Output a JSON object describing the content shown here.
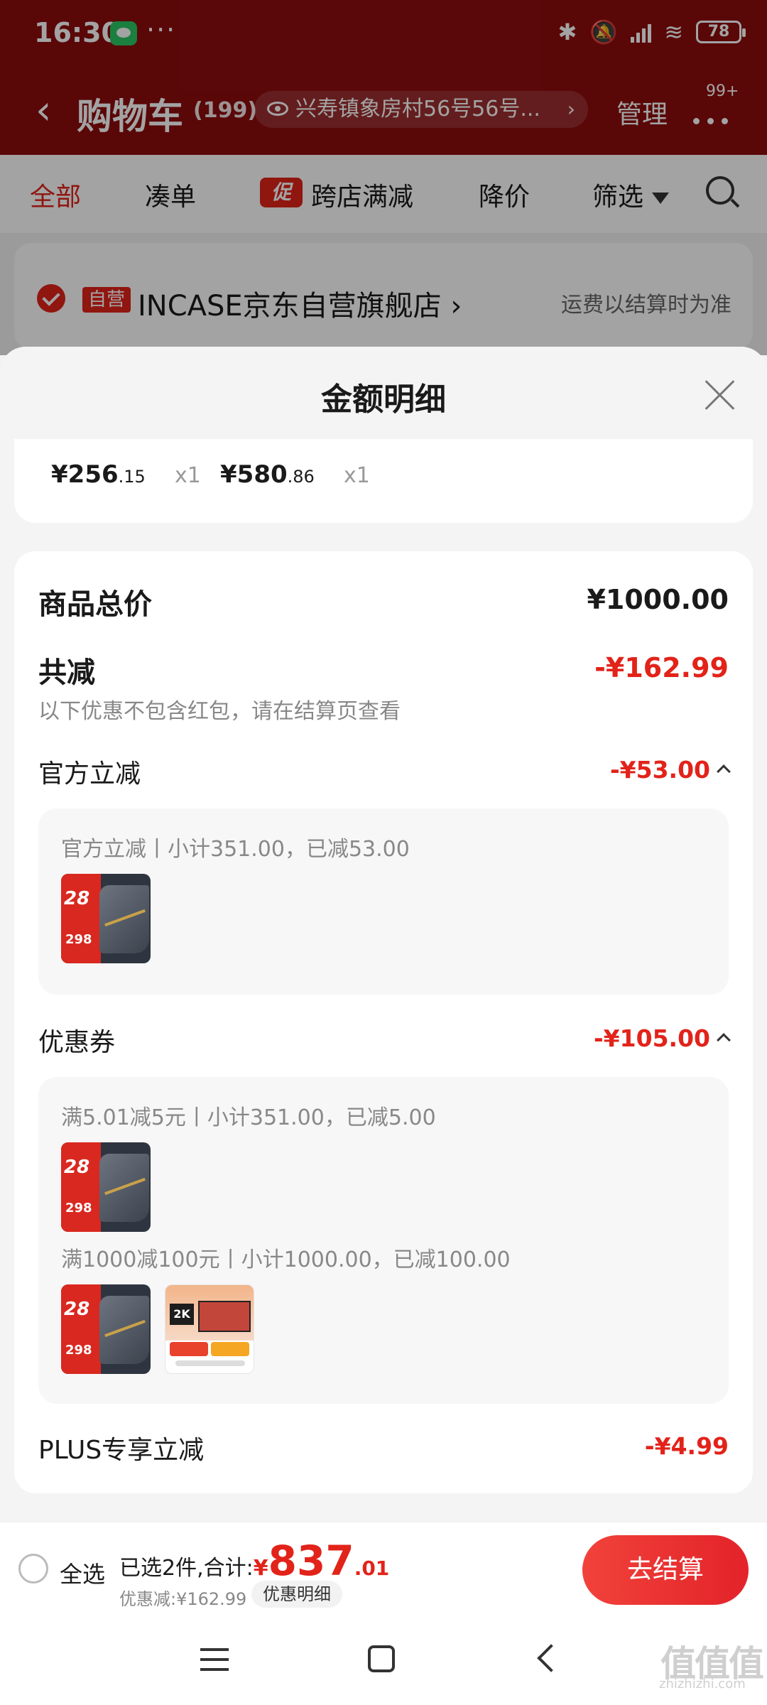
{
  "status_bar": {
    "time": "16:30",
    "dots": "···",
    "battery": "78"
  },
  "header": {
    "back": "‹",
    "title": "购物车",
    "count": "(199)",
    "address": "兴寿镇象房村56号56号...",
    "address_chevron": "›",
    "manage": "管理",
    "badge": "99+"
  },
  "tabs": {
    "all": "全部",
    "bundle": "凑单",
    "promo_tag": "促",
    "cross_store": "跨店满减",
    "price_drop": "降价",
    "filter": "筛选"
  },
  "store": {
    "self_tag": "自营",
    "name": "INCASE京东自营旗舰店",
    "name_chevron": "›",
    "shipping": "运费以结算时为准"
  },
  "sheet": {
    "title": "金额明细",
    "items": [
      {
        "price_int": "¥256",
        "price_dec": ".15",
        "qty": "x1"
      },
      {
        "price_int": "¥580",
        "price_dec": ".86",
        "qty": "x1"
      }
    ],
    "total_label": "商品总价",
    "total_value": "¥1000.00",
    "reduce_label": "共减",
    "reduce_value": "-¥162.99",
    "reduce_note": "以下优惠不包含红包，请在结算页查看",
    "official": {
      "label": "官方立减",
      "value": "-¥53.00",
      "detail": "官方立减丨小计351.00，已减53.00"
    },
    "coupon": {
      "label": "优惠券",
      "value": "-¥105.00",
      "detail1": "满5.01减5元丨小计351.00，已减5.00",
      "detail2": "满1000减100元丨小计1000.00，已减100.00"
    },
    "plus": {
      "label": "PLUS专享立减",
      "value": "-¥4.99"
    },
    "thumb_bag": {
      "n": "28",
      "price": "298"
    },
    "thumb_tv": {
      "res": "2K"
    }
  },
  "bottom": {
    "select_all": "全选",
    "selected_text": "已选2件,合计:",
    "currency": "¥",
    "total_int": "837",
    "total_dec": ".01",
    "discount": "优惠减:¥162.99",
    "discount_button": "优惠明细",
    "checkout": "去结算"
  },
  "watermark": {
    "text": "值值值",
    "url": "zhizhizhi.com"
  },
  "colors": {
    "header_red": "#8d0c0e",
    "accent_red": "#e2231a"
  }
}
